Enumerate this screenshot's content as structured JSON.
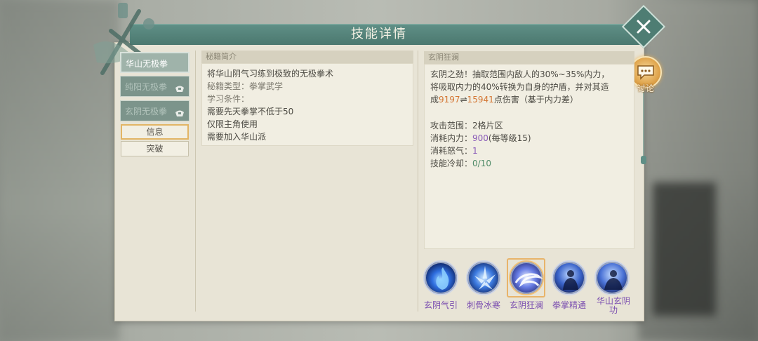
{
  "dialog": {
    "title": "技能详情"
  },
  "discuss": {
    "label": "讨论"
  },
  "skill_tabs": [
    {
      "label": "华山无极拳",
      "state": "active"
    },
    {
      "label": "纯阳无极拳",
      "state": "locked"
    },
    {
      "label": "玄阴无极拳",
      "state": "locked"
    }
  ],
  "side_buttons": [
    {
      "label": "信息",
      "selected": true
    },
    {
      "label": "突破",
      "selected": false
    }
  ],
  "manual_panel": {
    "header": "秘籍简介",
    "lines": [
      "将华山阴气习练到极致的无极拳术",
      "秘籍类型：拳掌武学",
      "学习条件：",
      "需要先天拳掌不低于50",
      "仅限主角使用",
      "需要加入华山派"
    ]
  },
  "skill_panel": {
    "header": "玄阴狂澜",
    "desc_line1": "玄阴之劲！抽取范围内敌人的30%~35%内力，",
    "desc_line2": "将吸取内力的40%转换为自身的护盾，并对其造",
    "desc_line3_prefix": "成",
    "damage_min": "9197",
    "damage_sep": "⇌",
    "damage_max": "15941",
    "desc_line3_suffix": "点伤害（基于内力差）",
    "stats": {
      "range_label": "攻击范围：",
      "range_value": "2格片区",
      "neili_label": "消耗内力：",
      "neili_value": "900",
      "neili_suffix": "(每等级15)",
      "nuqi_label": "消耗怒气：",
      "nuqi_value": "1",
      "cooldown_label": "技能冷却：",
      "cooldown_value": "0/10"
    }
  },
  "skills": [
    {
      "name": "玄阴气引",
      "icon": "blue-flame-icon"
    },
    {
      "name": "刺骨冰寒",
      "icon": "ice-shards-icon"
    },
    {
      "name": "玄阴狂澜",
      "icon": "swirl-wave-icon",
      "selected": true
    },
    {
      "name": "拳掌精通",
      "icon": "meditating-figure-icon"
    },
    {
      "name": "华山玄阴功",
      "icon": "meditating-figure-icon"
    }
  ],
  "colors": {
    "header_teal": "#4b786f",
    "panel_bg": "#f1eee2",
    "accent_orange": "#d47735",
    "accent_purple": "#8a5bb8",
    "accent_green": "#4e8a66",
    "selection_gold": "#e8b46a"
  }
}
